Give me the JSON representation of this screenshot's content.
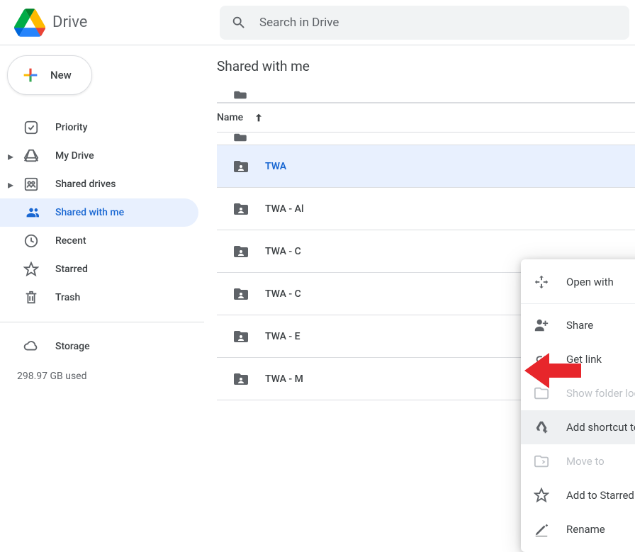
{
  "app_name": "Drive",
  "search": {
    "placeholder": "Search in Drive"
  },
  "new_button": "New",
  "sidebar": {
    "items": [
      {
        "label": "Priority"
      },
      {
        "label": "My Drive"
      },
      {
        "label": "Shared drives"
      },
      {
        "label": "Shared with me"
      },
      {
        "label": "Recent"
      },
      {
        "label": "Starred"
      },
      {
        "label": "Trash"
      }
    ],
    "storage_label": "Storage",
    "storage_used": "298.97 GB used"
  },
  "main": {
    "title": "Shared with me",
    "column_header": "Name",
    "rows": [
      {
        "name": "TWA"
      },
      {
        "name": "TWA - Al"
      },
      {
        "name": "TWA - C"
      },
      {
        "name": "TWA - C"
      },
      {
        "name": "TWA - E"
      },
      {
        "name": "TWA - M"
      }
    ]
  },
  "context_menu": {
    "open_with": "Open with",
    "share": "Share",
    "get_link": "Get link",
    "show_folder": "Show folder location",
    "add_shortcut": "Add shortcut to Drive",
    "move_to": "Move to",
    "add_starred": "Add to Starred",
    "rename": "Rename"
  }
}
